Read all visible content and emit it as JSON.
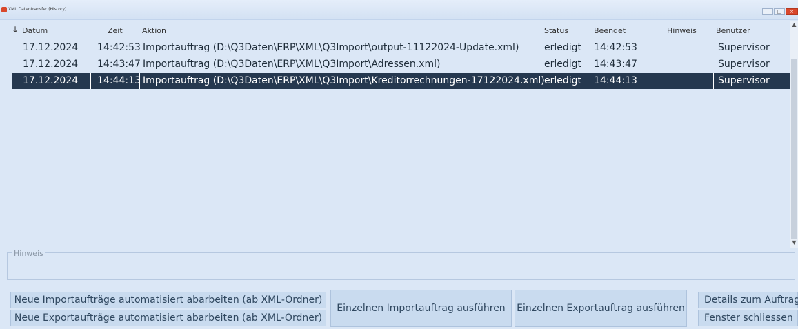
{
  "window": {
    "title": "XML Datentransfer (History)"
  },
  "table": {
    "columns": [
      "Datum",
      "Zeit",
      "Aktion",
      "Status",
      "Beendet",
      "Hinweis",
      "Benutzer"
    ],
    "rows": [
      {
        "datum": "17.12.2024",
        "zeit": "14:42:53",
        "aktion": "Importauftrag (D:\\Q3Daten\\ERP\\XML\\Q3Import\\output-11122024-Update.xml)",
        "status": "erledigt",
        "beendet": "14:42:53",
        "hinweis": "",
        "benutzer": "Supervisor"
      },
      {
        "datum": "17.12.2024",
        "zeit": "14:43:47",
        "aktion": "Importauftrag (D:\\Q3Daten\\ERP\\XML\\Q3Import\\Adressen.xml)",
        "status": "erledigt",
        "beendet": "14:43:47",
        "hinweis": "",
        "benutzer": "Supervisor"
      },
      {
        "datum": "17.12.2024",
        "zeit": "14:44:13",
        "aktion": "Importauftrag (D:\\Q3Daten\\ERP\\XML\\Q3Import\\Kreditorrechnungen-17122024.xml)",
        "status": "erledigt",
        "beendet": "14:44:13",
        "hinweis": "",
        "benutzer": "Supervisor"
      }
    ]
  },
  "hinweis": {
    "label": "Hinweis",
    "value": ""
  },
  "buttons": {
    "neue_import": "Neue Importaufträge automatisiert abarbeiten (ab XML-Ordner)",
    "neue_export": "Neue Exportaufträge automatisiert abarbeiten (ab XML-Ordner)",
    "einzeln_import": "Einzelnen Importauftrag ausführen",
    "einzeln_export": "Einzelnen Exportauftrag ausführen",
    "details": "Details zum Auftrag",
    "close": "Fenster schliessen"
  },
  "icons": {
    "app": "app-logo-icon",
    "sort": "sort-arrow-icon",
    "minimize": "minimize-icon",
    "maximize": "maximize-icon",
    "close": "close-icon"
  },
  "colors": {
    "selected_row": "#25384f",
    "window_bg": "#dbe7f6",
    "button_bg": "#c9dbef",
    "close_button": "#d9472b"
  }
}
